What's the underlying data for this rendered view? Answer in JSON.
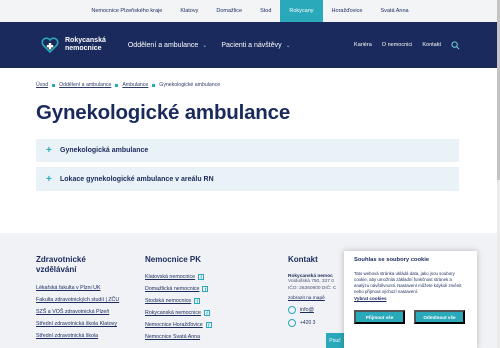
{
  "topbar": {
    "items": [
      "Nemocnice Plzeňského kraje",
      "Klatovy",
      "Domažlice",
      "Stod",
      "Rokycany",
      "Horažďovice",
      "Svatá Anna"
    ],
    "active_index": 4
  },
  "header": {
    "logo_line1": "Rokycanská",
    "logo_line2": "nemocnice",
    "nav": [
      "Oddělení a ambulance",
      "Pacienti a návštěvy"
    ],
    "links": [
      "Kariéra",
      "O nemocnici",
      "Kontakt"
    ],
    "search_icon": "search-icon"
  },
  "breadcrumb": [
    "Úvod",
    "Oddělení a ambulance",
    "Ambulance",
    "Gynekologické ambulance"
  ],
  "page_title": "Gynekologické ambulance",
  "accordion": [
    {
      "label": "Gynekologická ambulance"
    },
    {
      "label": "Lokace gynekologické ambulance v areálu RN"
    }
  ],
  "footer": {
    "col1": {
      "heading_line1": "Zdravotnické",
      "heading_line2": "vzdělávání",
      "links": [
        "Lékařská fakulta v Plzni UK",
        "Fakulta zdravotnických studií | ZČU",
        "SZŠ a VOŠ zdravotnická Plzeň",
        "Střední zdravotnická škola Klatovy",
        "Střední zdravotnická škola"
      ]
    },
    "col2": {
      "heading": "Nemocnice PK",
      "links": [
        "Klatovská nemocnice",
        "Domažlická nemocnice",
        "Stodská nemocnice",
        "Rokycanská nemocnice",
        "Nemocnice Horažďovice",
        "Nemocnice Svatá Anna"
      ]
    },
    "col3": {
      "heading": "Kontakt",
      "name": "Rokycanská nemoc",
      "addr": "Voldušská 750, 337 0",
      "ico": "IČO: 26360900 DIČ: C",
      "map": "zobrazit na mapě",
      "email": "info@",
      "phone": "+420 3"
    }
  },
  "cookie": {
    "title": "Souhlas se soubory cookie",
    "text": "Tato webová stránka ukládá data, jako jsou soubory cookie, aby umožnila základní funkčnost stránek a analýzu návštěvnosti. Nastavení můžete kdykoli změnit nebo přijmout výchozí nastavení.",
    "link": "Vybrat cookies",
    "accept": "Přijmout vše",
    "reject": "Odmítnout vše"
  },
  "bottom_tab": "Pouč",
  "colors": {
    "navy": "#1a2a5c",
    "teal": "#2aa9ba"
  }
}
